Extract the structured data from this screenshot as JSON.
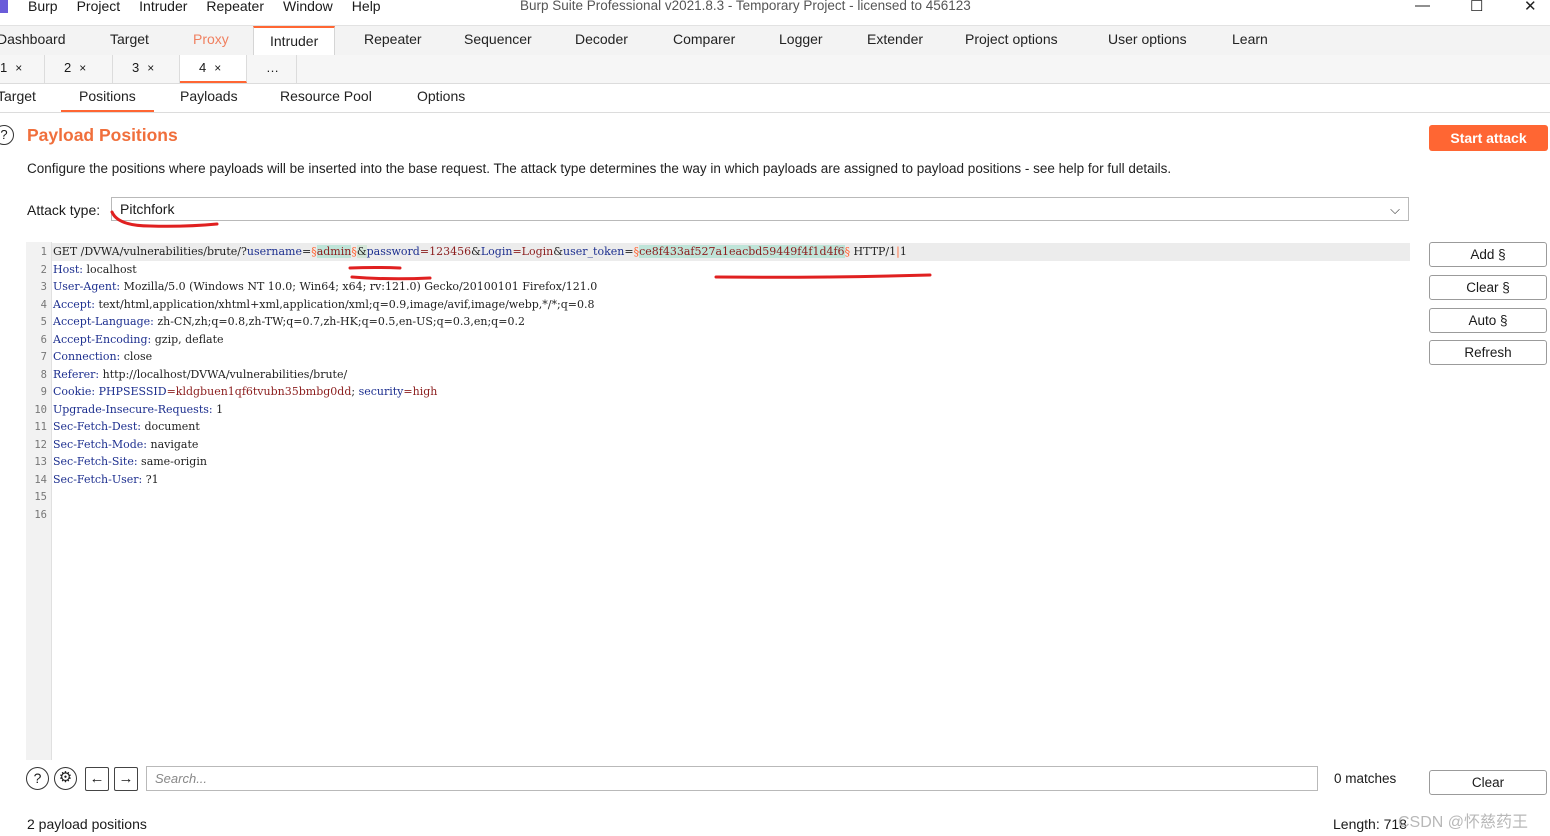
{
  "window": {
    "title": "Burp Suite Professional v2021.8.3 - Temporary Project - licensed to 456123",
    "menu": [
      "Burp",
      "Project",
      "Intruder",
      "Repeater",
      "Window",
      "Help"
    ],
    "controls": {
      "minimize": "—",
      "maximize": "☐",
      "close": "✕"
    }
  },
  "main_tabs": [
    "Dashboard",
    "Target",
    "Proxy",
    "Intruder",
    "Repeater",
    "Sequencer",
    "Decoder",
    "Comparer",
    "Logger",
    "Extender",
    "Project options",
    "User options",
    "Learn"
  ],
  "active_main_tab": "Intruder",
  "attack_tabs": [
    {
      "label": "1",
      "close": "×"
    },
    {
      "label": "2",
      "close": "×"
    },
    {
      "label": "3",
      "close": "×"
    },
    {
      "label": "4",
      "close": "×"
    },
    {
      "label": "…",
      "close": ""
    }
  ],
  "active_attack_tab": "4",
  "section_tabs": [
    "Target",
    "Positions",
    "Payloads",
    "Resource Pool",
    "Options"
  ],
  "active_section_tab": "Positions",
  "positions": {
    "title": "Payload Positions",
    "description": "Configure the positions where payloads will be inserted into the base request. The attack type determines the way in which payloads are assigned to payload positions - see help for full details.",
    "attack_type_label": "Attack type:",
    "attack_type_value": "Pitchfork",
    "start_attack": "Start attack"
  },
  "request": {
    "line1": {
      "method_path": "GET /DVWA/vulnerabilities/brute/?",
      "k_username": "username",
      "eq1": "=",
      "m1": "§",
      "p1": "admin",
      "m2": "§",
      "amp1": "&",
      "k_password": "password",
      "v_password": "=123456",
      "amp2": "&",
      "k_login": "Login",
      "v_login": "=Login",
      "amp3": "&",
      "k_token": "user_token",
      "eq2": "=",
      "m3": "§",
      "p2": "ce8f433af527a1eacbd59449f4f1d4f6",
      "m4": "§",
      "proto": " HTTP/1",
      "cursor": "|",
      "proto_end": "1"
    },
    "headers": [
      {
        "key": "Host:",
        "value": " localhost"
      },
      {
        "key": "User-Agent:",
        "value": " Mozilla/5.0 (Windows NT 10.0; Win64; x64; rv:121.0) Gecko/20100101 Firefox/121.0"
      },
      {
        "key": "Accept:",
        "value": " text/html,application/xhtml+xml,application/xml;q=0.9,image/avif,image/webp,*/*;q=0.8"
      },
      {
        "key": "Accept-Language:",
        "value": " zh-CN,zh;q=0.8,zh-TW;q=0.7,zh-HK;q=0.5,en-US;q=0.3,en;q=0.2"
      },
      {
        "key": "Accept-Encoding:",
        "value": " gzip, deflate"
      },
      {
        "key": "Connection:",
        "value": " close"
      },
      {
        "key": "Referer:",
        "value": " http://localhost/DVWA/vulnerabilities/brute/"
      },
      {
        "key": "Cookie:",
        "value": " "
      },
      {
        "key": "Upgrade-Insecure-Requests:",
        "value": " 1"
      },
      {
        "key": "Sec-Fetch-Dest:",
        "value": " document"
      },
      {
        "key": "Sec-Fetch-Mode:",
        "value": " navigate"
      },
      {
        "key": "Sec-Fetch-Site:",
        "value": " same-origin"
      },
      {
        "key": "Sec-Fetch-User:",
        "value": " ?1"
      }
    ],
    "cookie": {
      "k1": "PHPSESSID",
      "v1": "=kldgbuen1qf6tvubn35bmbg0dd",
      "sep": "; ",
      "k2": "security",
      "v2": "=high"
    },
    "line_numbers": [
      "1",
      "2",
      "3",
      "4",
      "5",
      "6",
      "7",
      "8",
      "9",
      "10",
      "11",
      "12",
      "13",
      "14",
      "15",
      "16"
    ]
  },
  "side_buttons": {
    "add": "Add §",
    "clear": "Clear §",
    "auto": "Auto §",
    "refresh": "Refresh"
  },
  "search": {
    "placeholder": "Search...",
    "matches": "0 matches",
    "clear": "Clear"
  },
  "status": {
    "positions": "2 payload positions",
    "length": "Length: 718"
  },
  "watermark": "CSDN @怀慈药王",
  "colors": {
    "accent": "#ff6633",
    "title": "#f06f3c",
    "annotation": "#e02020"
  }
}
